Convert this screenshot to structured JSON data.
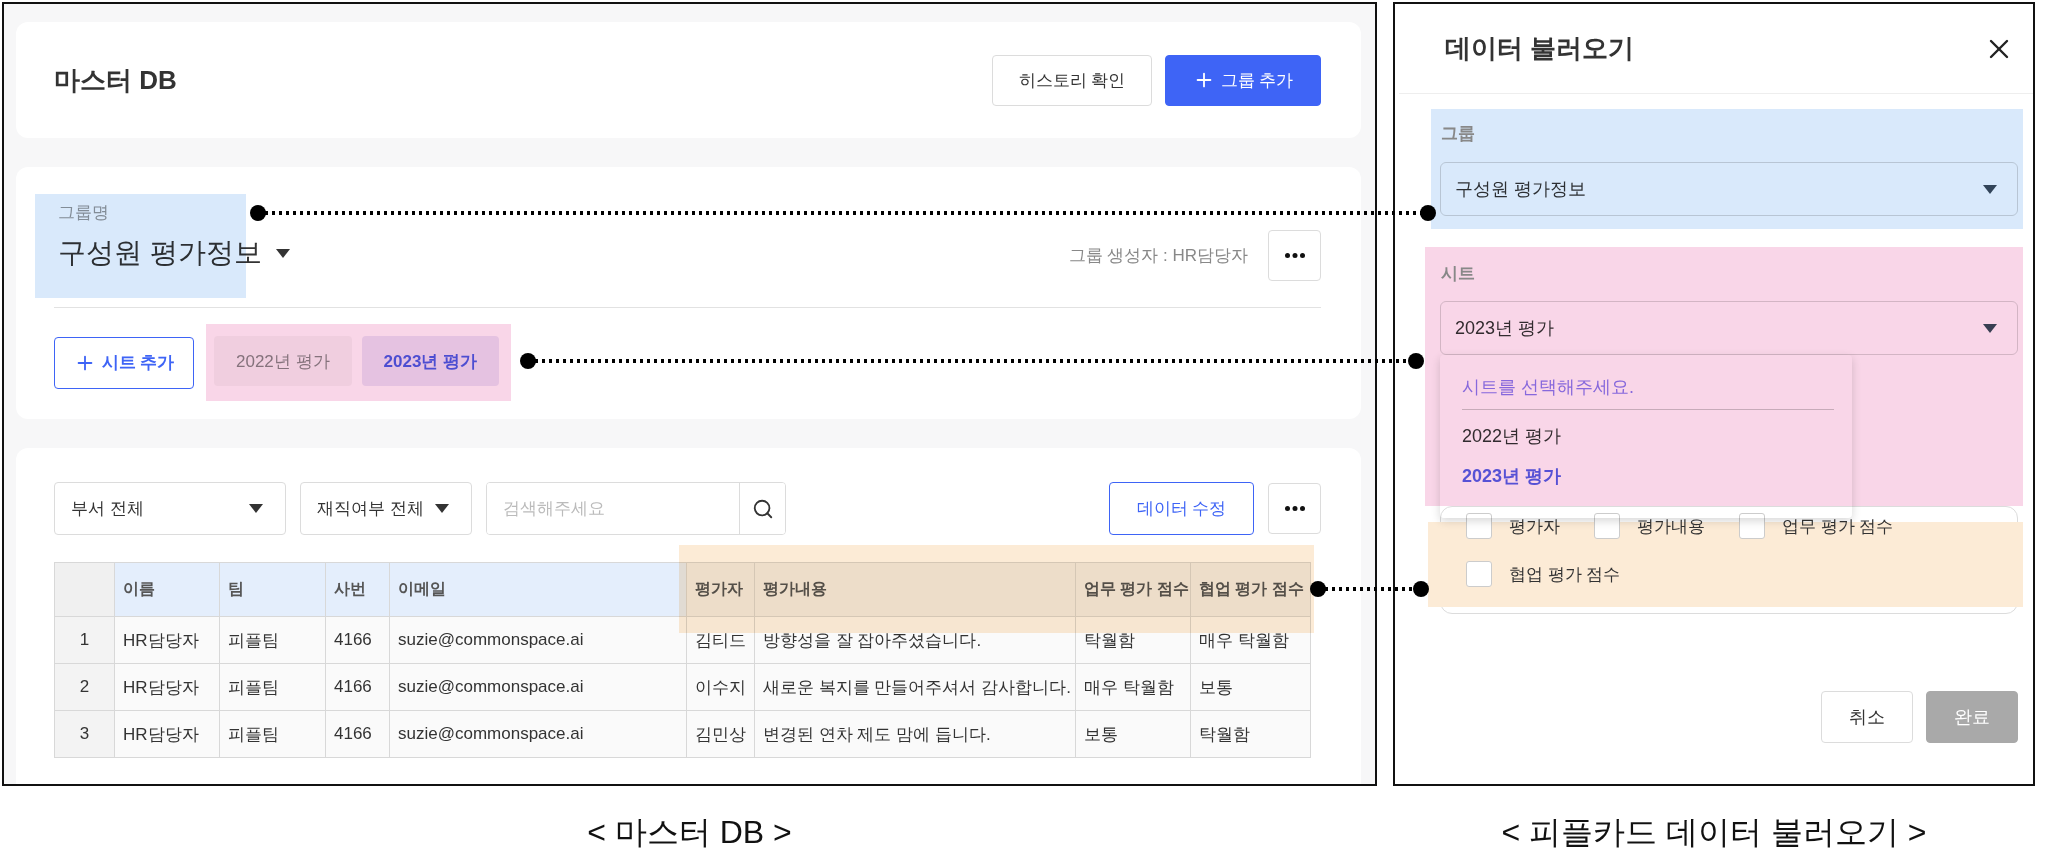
{
  "master_db": {
    "title": "마스터 DB",
    "header_buttons": [
      {
        "label": "히스토리 확인",
        "kind": "outline"
      },
      {
        "label": "그룹 추가",
        "kind": "primary"
      }
    ],
    "group": {
      "label": "그룹명",
      "name": "구성원 평가정보",
      "creator": "그룹 생성자 : HR담당자"
    },
    "add_sheet_button": "시트 추가",
    "sheets": [
      {
        "label": "2022년 평가",
        "selected": false
      },
      {
        "label": "2023년 평가",
        "selected": true
      }
    ],
    "filters": [
      {
        "value": "부서 전체"
      },
      {
        "value": "재직여부 전체"
      }
    ],
    "search": {
      "placeholder": "검색해주세요"
    },
    "edit_button": "데이터 수정",
    "table": {
      "columns": [
        {
          "label": "이름",
          "kind": "basic"
        },
        {
          "label": "팀",
          "kind": "basic"
        },
        {
          "label": "사번",
          "kind": "basic"
        },
        {
          "label": "이메일",
          "kind": "basic"
        },
        {
          "label": "평가자",
          "kind": "evaluation"
        },
        {
          "label": "평가내용",
          "kind": "evaluation"
        },
        {
          "label": "업무 평가 점수",
          "kind": "evaluation"
        },
        {
          "label": "협업 평가 점수",
          "kind": "evaluation"
        }
      ],
      "rows": [
        {
          "index": "1",
          "cells": [
            "HR담당자",
            "피플팀",
            "4166",
            "suzie@commonspace.ai",
            "김티드",
            "방향성을 잘 잡아주셨습니다.",
            "탁월함",
            "매우 탁월함"
          ]
        },
        {
          "index": "2",
          "cells": [
            "HR담당자",
            "피플팀",
            "4166",
            "suzie@commonspace.ai",
            "이수지",
            "새로운 복지를 만들어주셔서 감사합니다.",
            "매우 탁월함",
            "보통"
          ]
        },
        {
          "index": "3",
          "cells": [
            "HR담당자",
            "피플팀",
            "4166",
            "suzie@commonspace.ai",
            "김민상",
            "변경된 연차 제도 맘에 듭니다.",
            "보통",
            "탁월함"
          ]
        }
      ]
    }
  },
  "load_dialog": {
    "title": "데이터 불러오기",
    "group": {
      "label": "그룹",
      "value": "구성원 평가정보"
    },
    "sheet": {
      "label": "시트",
      "value": "2023년 평가",
      "expanded": true,
      "menu_prompt": "시트를 선택해주세요.",
      "options": [
        {
          "label": "2022년 평가",
          "selected": false
        },
        {
          "label": "2023년 평가",
          "selected": true
        }
      ]
    },
    "fields": [
      {
        "label": "평가자",
        "checked": false
      },
      {
        "label": "평가내용",
        "checked": false
      },
      {
        "label": "업무 평가 점수",
        "checked": false
      },
      {
        "label": "협업 평가 점수",
        "checked": false
      }
    ],
    "buttons": [
      {
        "label": "취소",
        "kind": "secondary",
        "disabled": false
      },
      {
        "label": "완료",
        "kind": "primary",
        "disabled": true
      }
    ]
  },
  "captions": [
    "< 마스터 DB >",
    "< 피플카드 데이터 불러오기 >"
  ],
  "highlights": [
    {
      "color": "#d9e9fb"
    },
    {
      "color": "#f9d6e8"
    },
    {
      "color": "#fcebd6"
    }
  ]
}
